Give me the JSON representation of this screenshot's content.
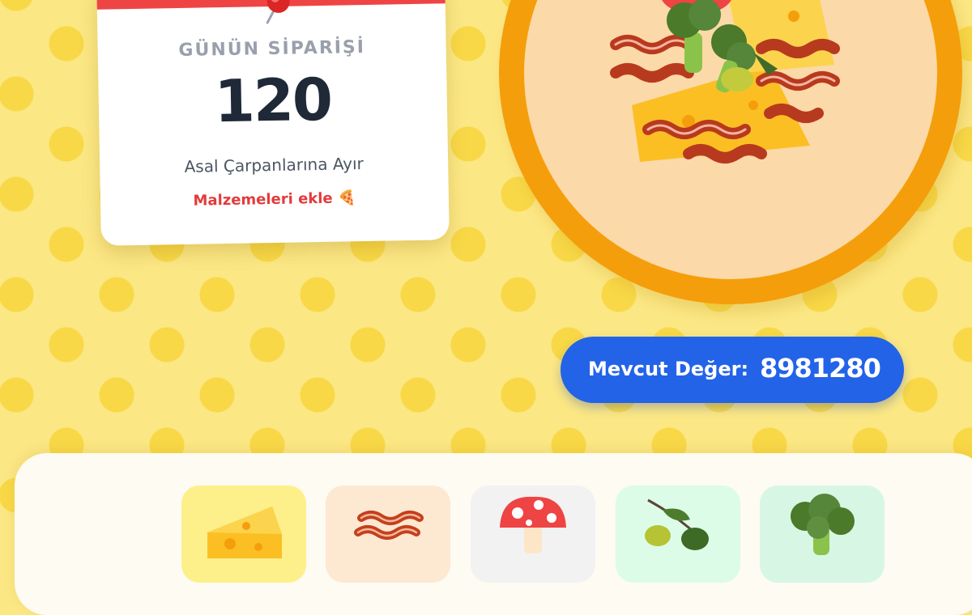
{
  "order": {
    "label": "GÜNÜN SİPARİŞİ",
    "number": "120",
    "instruction": "Asal Çarpanlarına Ayır",
    "hint": "Malzemeleri ekle 🍕"
  },
  "current": {
    "label": "Mevcut Değer:",
    "value": "8981280"
  },
  "ingredients": [
    {
      "name": "cheese",
      "icon": "cheese-icon",
      "color": "#fdf08a"
    },
    {
      "name": "bacon",
      "icon": "bacon-icon",
      "color": "#fde8d2"
    },
    {
      "name": "mushroom",
      "icon": "mushroom-icon",
      "color": "#f2f2f2"
    },
    {
      "name": "olive",
      "icon": "olive-icon",
      "color": "#dcfce7"
    },
    {
      "name": "broccoli",
      "icon": "broccoli-icon",
      "color": "#d7f7e4"
    }
  ],
  "colors": {
    "background": "#fbe784",
    "card_band": "#ef4444",
    "plate": "#f59e0b",
    "value_pill": "#2363e8"
  }
}
